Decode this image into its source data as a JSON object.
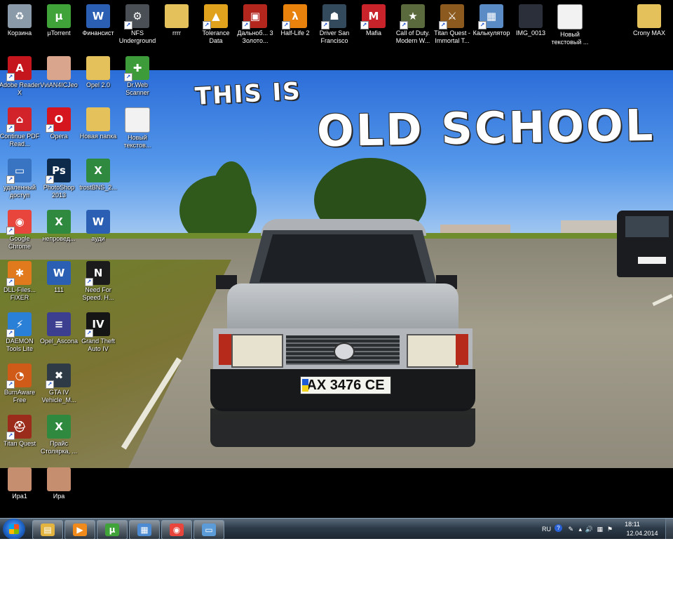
{
  "wallpaper": {
    "title_small": "THIS IS",
    "title_big": "OLD SCHOOL",
    "plate": "AX 3476 CE"
  },
  "desktop_icons": [
    {
      "name": "recycle-bin-icon",
      "label": "Корзина",
      "color": "#8a9aa8",
      "glyph": "♻",
      "shortcut": false
    },
    {
      "name": "utorrent-icon",
      "label": "µTorrent",
      "color": "#3fa33a",
      "glyph": "µ",
      "shortcut": false
    },
    {
      "name": "word-document-icon",
      "label": "Финансист",
      "color": "#2b5fb4",
      "glyph": "W",
      "shortcut": false
    },
    {
      "name": "nfs-underground-icon",
      "label": "NFS Underground",
      "color": "#4a4f56",
      "glyph": "⚙",
      "shortcut": true
    },
    {
      "name": "folder-icon",
      "label": "rrrr",
      "color": "#e4c15a",
      "glyph": "",
      "shortcut": false
    },
    {
      "name": "tolerance-data-icon",
      "label": "Tolerance Data",
      "color": "#e0a21d",
      "glyph": "▲",
      "shortcut": true
    },
    {
      "name": "dalnoboyshchiki-icon",
      "label": "Дальноб... 3 Золото...",
      "color": "#b3261e",
      "glyph": "▣",
      "shortcut": true
    },
    {
      "name": "half-life-2-icon",
      "label": "Half-Life 2",
      "color": "#e8820c",
      "glyph": "λ",
      "shortcut": true
    },
    {
      "name": "driver-san-francisco-icon",
      "label": "Driver San Francisco",
      "color": "#334a5c",
      "glyph": "☗",
      "shortcut": true
    },
    {
      "name": "mafia-icon",
      "label": "Mafia",
      "color": "#c8232a",
      "glyph": "M",
      "shortcut": true
    },
    {
      "name": "call-of-duty-icon",
      "label": "Call of Duty. Modern W...",
      "color": "#5b6a3c",
      "glyph": "★",
      "shortcut": true
    },
    {
      "name": "titan-quest-it-icon",
      "label": "Titan Quest - Immortal T...",
      "color": "#8c5a1e",
      "glyph": "⚔",
      "shortcut": true
    },
    {
      "name": "calculator-icon",
      "label": "Калькулятор",
      "color": "#5a8bc4",
      "glyph": "▦",
      "shortcut": true
    },
    {
      "name": "image-file-icon",
      "label": "IMG_0013",
      "color": "#2a2f3a",
      "glyph": "",
      "shortcut": false
    },
    {
      "name": "text-file-icon",
      "label": "Новый текстовый ...",
      "color": "#f2f2f2",
      "glyph": "",
      "shortcut": false
    },
    {
      "name": "folder-icon",
      "label": "Crony MAX",
      "color": "#e4c15a",
      "glyph": "",
      "shortcut": false
    },
    {
      "name": "adobe-reader-icon",
      "label": "Adobe Reader X",
      "color": "#c4161c",
      "glyph": "A",
      "shortcut": true
    },
    {
      "name": "photo-file-icon",
      "label": "VviAN4ICJeo",
      "color": "#d9a58c",
      "glyph": "",
      "shortcut": false
    },
    {
      "name": "folder-icon",
      "label": "Opel 2.0",
      "color": "#e4c15a",
      "glyph": "",
      "shortcut": false
    },
    {
      "name": "drweb-scanner-icon",
      "label": "Dr.Web Scanner",
      "color": "#3d9b3a",
      "glyph": "✚",
      "shortcut": true
    },
    {
      "name": "pdf-reader-icon",
      "label": "Continue PDF Read...",
      "color": "#d2232a",
      "glyph": "⌂",
      "shortcut": true
    },
    {
      "name": "opera-icon",
      "label": "Opera",
      "color": "#d6161f",
      "glyph": "O",
      "shortcut": true
    },
    {
      "name": "folder-icon",
      "label": "Новая папка",
      "color": "#e4c15a",
      "glyph": "",
      "shortcut": false
    },
    {
      "name": "text-file-icon",
      "label": "Новый текстов...",
      "color": "#f2f2f2",
      "glyph": "",
      "shortcut": false
    },
    {
      "name": "remote-desktop-icon",
      "label": "удаленный доступ",
      "color": "#3874c2",
      "glyph": "▭",
      "shortcut": true
    },
    {
      "name": "photoshop-icon",
      "label": "PhotoShop 2013",
      "color": "#0d2a4a",
      "glyph": "Ps",
      "shortcut": true
    },
    {
      "name": "excel-document-icon",
      "label": "trostBNS_2...",
      "color": "#2f8a3f",
      "glyph": "X",
      "shortcut": false
    },
    {
      "name": "google-chrome-icon",
      "label": "Google Chrome",
      "color": "#e8453c",
      "glyph": "◉",
      "shortcut": true
    },
    {
      "name": "excel-document-icon",
      "label": "непровед...",
      "color": "#2f8a3f",
      "glyph": "X",
      "shortcut": false
    },
    {
      "name": "word-document-icon",
      "label": "ауди",
      "color": "#2b5fb4",
      "glyph": "W",
      "shortcut": false
    },
    {
      "name": "dll-files-fixer-icon",
      "label": "DLL-Files... FIXER",
      "color": "#e07a1c",
      "glyph": "✱",
      "shortcut": true
    },
    {
      "name": "word-document-icon",
      "label": "111",
      "color": "#2b5fb4",
      "glyph": "W",
      "shortcut": false
    },
    {
      "name": "need-for-speed-icon",
      "label": "Need For Speed. H...",
      "color": "#1b1b1b",
      "glyph": "N",
      "shortcut": true
    },
    {
      "name": "daemon-tools-icon",
      "label": "DAEMON Tools Lite",
      "color": "#2a7fd6",
      "glyph": "⚡",
      "shortcut": true
    },
    {
      "name": "document-file-icon",
      "label": "Opel_Ascona",
      "color": "#3c3f8f",
      "glyph": "≡",
      "shortcut": false
    },
    {
      "name": "gta-iv-icon",
      "label": "Grand Theft Auto IV",
      "color": "#151515",
      "glyph": "IV",
      "shortcut": true
    },
    {
      "name": "burnaware-icon",
      "label": "BurnAware Free",
      "color": "#d05a17",
      "glyph": "◔",
      "shortcut": true
    },
    {
      "name": "gta-vehicle-icon",
      "label": "GTA IV Vehicle_M...",
      "color": "#2e3b46",
      "glyph": "✖",
      "shortcut": true
    },
    {
      "name": "titan-quest-icon",
      "label": "Titan Quest",
      "color": "#9b2b1a",
      "glyph": "⛑",
      "shortcut": true
    },
    {
      "name": "excel-document-icon",
      "label": "Прайс Столярка, ...",
      "color": "#2f8a3f",
      "glyph": "X",
      "shortcut": false
    },
    {
      "name": "photo-file-icon",
      "label": "Ира1",
      "color": "#c58f6f",
      "glyph": "",
      "shortcut": false
    },
    {
      "name": "photo-file-icon",
      "label": "Ира",
      "color": "#c58f6f",
      "glyph": "",
      "shortcut": false
    }
  ],
  "taskbar": {
    "pinned": [
      {
        "name": "windows-explorer-taskbar-button",
        "glyph": "▤",
        "color": "#e2b33e"
      },
      {
        "name": "media-player-taskbar-button",
        "glyph": "▶",
        "color": "#f08a1c"
      },
      {
        "name": "utorrent-taskbar-button",
        "glyph": "µ",
        "color": "#3fa33a"
      },
      {
        "name": "control-panel-taskbar-button",
        "glyph": "▦",
        "color": "#4c8ad1"
      },
      {
        "name": "chrome-taskbar-button",
        "glyph": "◉",
        "color": "#e8453c"
      },
      {
        "name": "picture-viewer-taskbar-button",
        "glyph": "▭",
        "color": "#5a9bd8"
      }
    ],
    "language": "RU",
    "time": "18:11",
    "date": "12.04.2014"
  }
}
